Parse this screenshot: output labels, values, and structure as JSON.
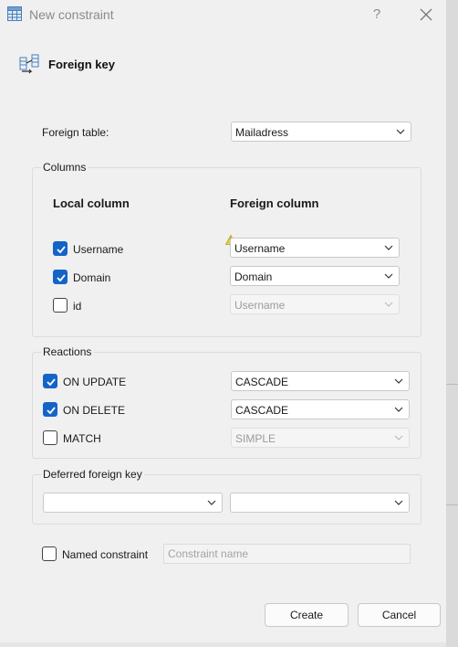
{
  "window": {
    "title": "New constraint",
    "help": "?"
  },
  "header": {
    "title": "Foreign key"
  },
  "foreign_table": {
    "label": "Foreign table:",
    "value": "Mailadress"
  },
  "columns": {
    "group_title": "Columns",
    "local_header": "Local column",
    "foreign_header": "Foreign column",
    "rows": [
      {
        "local": "Username",
        "checked": true,
        "foreign": "Username",
        "enabled": true
      },
      {
        "local": "Domain",
        "checked": true,
        "foreign": "Domain",
        "enabled": true
      },
      {
        "local": "id",
        "checked": false,
        "foreign": "Username",
        "enabled": false
      }
    ]
  },
  "reactions": {
    "group_title": "Reactions",
    "rows": [
      {
        "label": "ON UPDATE",
        "checked": true,
        "value": "CASCADE",
        "enabled": true
      },
      {
        "label": "ON DELETE",
        "checked": true,
        "value": "CASCADE",
        "enabled": true
      },
      {
        "label": "MATCH",
        "checked": false,
        "value": "SIMPLE",
        "enabled": false
      }
    ]
  },
  "deferred": {
    "group_title": "Deferred foreign key",
    "left_value": "",
    "right_value": ""
  },
  "named": {
    "label": "Named constraint",
    "checked": false,
    "placeholder": "Constraint name"
  },
  "buttons": {
    "create": "Create",
    "cancel": "Cancel"
  },
  "colors": {
    "accent": "#1464c8",
    "warning": "#e8d23a"
  }
}
